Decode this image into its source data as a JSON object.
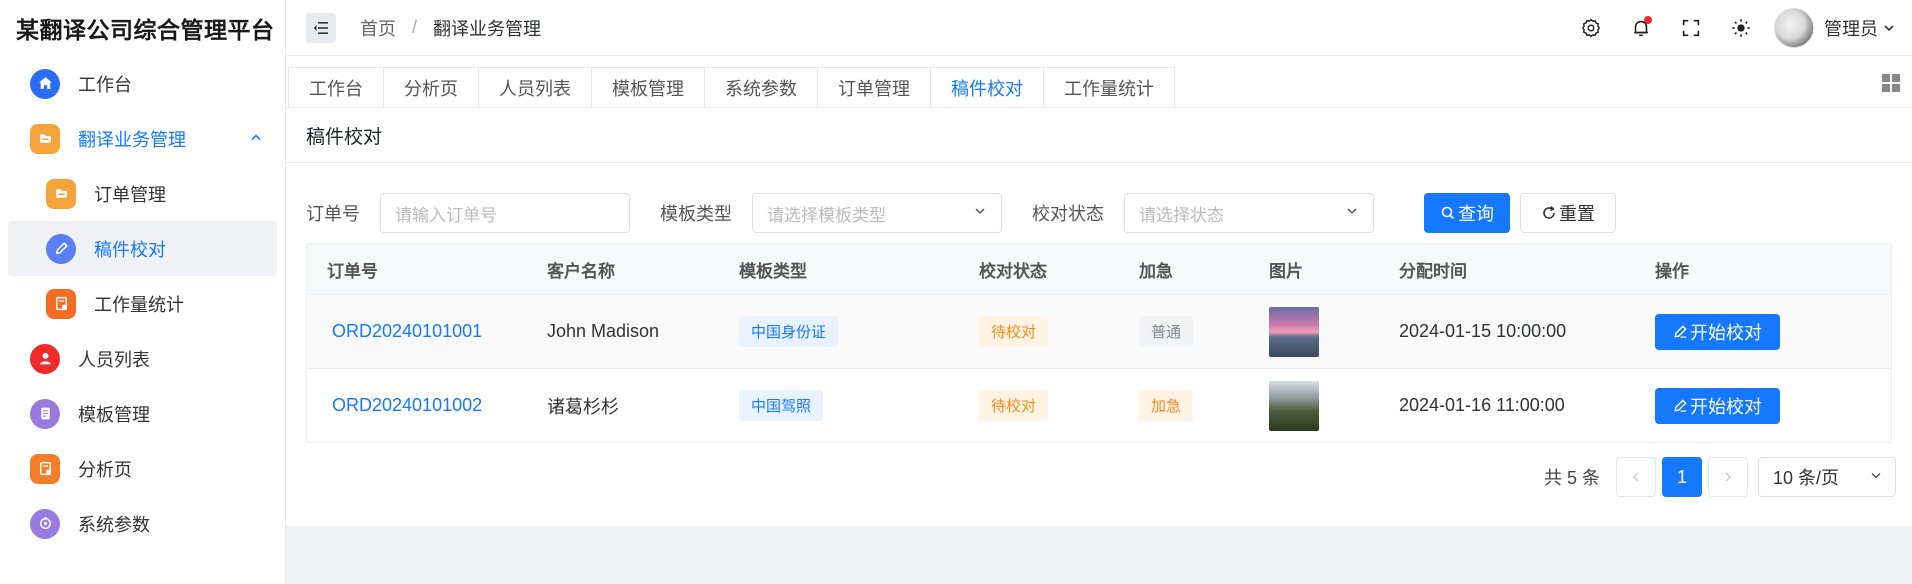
{
  "app": {
    "title": "某翻译公司综合管理平台"
  },
  "sidebar": {
    "items": [
      {
        "label": "工作台"
      },
      {
        "label": "翻译业务管理"
      },
      {
        "label": "订单管理"
      },
      {
        "label": "稿件校对"
      },
      {
        "label": "工作量统计"
      },
      {
        "label": "人员列表"
      },
      {
        "label": "模板管理"
      },
      {
        "label": "分析页"
      },
      {
        "label": "系统参数"
      }
    ]
  },
  "header": {
    "breadcrumb": {
      "home": "首页",
      "separator": "/",
      "current": "翻译业务管理"
    },
    "user": {
      "name": "管理员"
    }
  },
  "tabs": [
    {
      "label": "工作台"
    },
    {
      "label": "分析页"
    },
    {
      "label": "人员列表"
    },
    {
      "label": "模板管理"
    },
    {
      "label": "系统参数"
    },
    {
      "label": "订单管理"
    },
    {
      "label": "稿件校对"
    },
    {
      "label": "工作量统计"
    }
  ],
  "page": {
    "title": "稿件校对"
  },
  "filters": {
    "order_label": "订单号",
    "order_placeholder": "请输入订单号",
    "template_label": "模板类型",
    "template_placeholder": "请选择模板类型",
    "status_label": "校对状态",
    "status_placeholder": "请选择状态",
    "query_label": "查询",
    "reset_label": "重置"
  },
  "table": {
    "columns": [
      "订单号",
      "客户名称",
      "模板类型",
      "校对状态",
      "加急",
      "图片",
      "分配时间",
      "操作"
    ],
    "rows": [
      {
        "order": "ORD20240101001",
        "customer": "John Madison",
        "template": "中国身份证",
        "status": "待校对",
        "urgent": "普通",
        "time": "2024-01-15 10:00:00",
        "action": "开始校对"
      },
      {
        "order": "ORD20240101002",
        "customer": "诸葛杉杉",
        "template": "中国驾照",
        "status": "待校对",
        "urgent": "加急",
        "time": "2024-01-16 11:00:00",
        "action": "开始校对"
      }
    ]
  },
  "pagination": {
    "total": "共 5 条",
    "current": "1",
    "page_size": "10 条/页"
  },
  "colors": {
    "primary": "#1677ff",
    "warning": "#f48a1b",
    "danger": "#f5222d"
  }
}
